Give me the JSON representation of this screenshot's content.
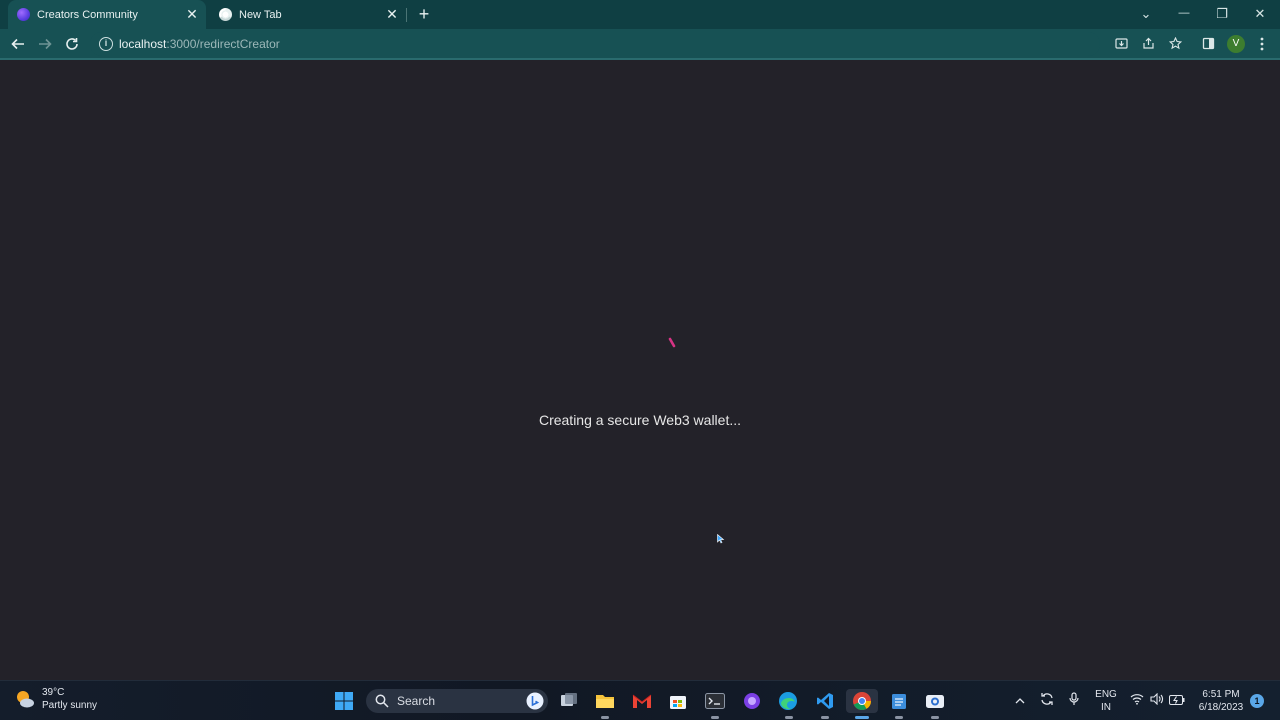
{
  "browser": {
    "tabs": [
      {
        "title": "Creators Community",
        "active": true
      },
      {
        "title": "New Tab",
        "active": false
      }
    ],
    "close_glyph": "✕",
    "new_tab_glyph": "+",
    "window_controls": {
      "tab_search": "⌄",
      "minimize": "—",
      "restore": "❐",
      "close": "✕"
    },
    "url_host": "localhost",
    "url_path": ":3000/redirectCreator",
    "profile_initial": "V",
    "icons": {
      "back": "back-arrow-icon",
      "forward": "forward-arrow-icon",
      "reload": "reload-icon",
      "info": "info-icon",
      "install": "install-app-icon",
      "share": "share-icon",
      "bookmark": "star-icon",
      "sidepanel": "side-panel-icon",
      "menu": "kebab-menu-icon"
    }
  },
  "page": {
    "loading_text": "Creating a secure Web3 wallet...",
    "spinner_color": "#d63384"
  },
  "taskbar": {
    "weather_temp": "39°C",
    "weather_desc": "Partly sunny",
    "search_label": "Search",
    "lang_line1": "ENG",
    "lang_line2": "IN",
    "time": "6:51 PM",
    "date": "6/18/2023",
    "notification_count": "1"
  }
}
